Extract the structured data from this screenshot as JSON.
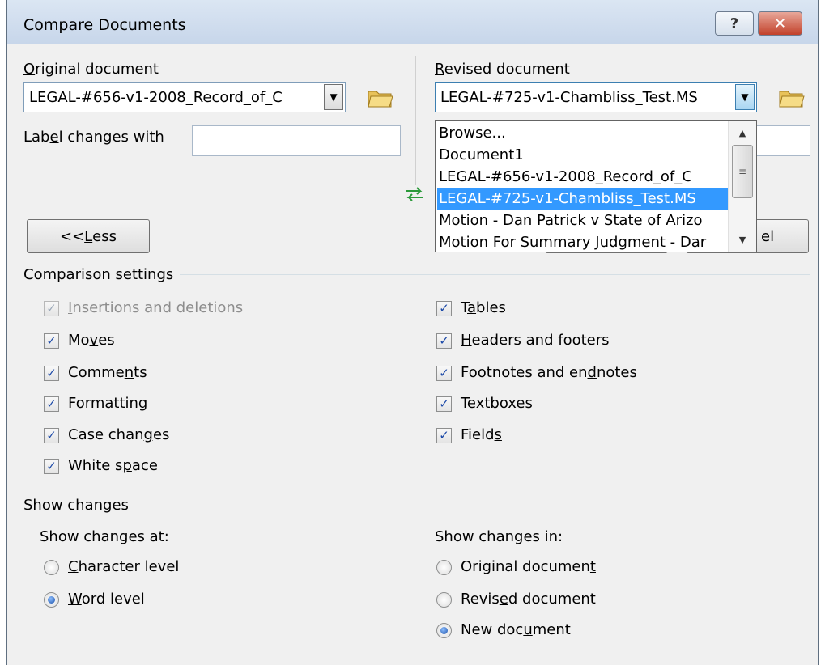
{
  "window": {
    "title": "Compare Documents",
    "help_label": "?",
    "close_label": "✕"
  },
  "original": {
    "label_pre": "",
    "label_u": "O",
    "label_post": "riginal document",
    "value": "LEGAL-#656-v1-2008_Record_of_C"
  },
  "revised": {
    "label_pre": "",
    "label_u": "R",
    "label_post": "evised document",
    "value": "LEGAL-#725-v1-Chambliss_Test.MS"
  },
  "label_changes": {
    "pre": "Lab",
    "u": "e",
    "post": "l changes with",
    "value": ""
  },
  "less_button": {
    "pre": "<< ",
    "u": "L",
    "post": "ess"
  },
  "cancel_partial": "el",
  "dropdown": {
    "items": [
      "Browse...",
      "Document1",
      "LEGAL-#656-v1-2008_Record_of_C",
      "LEGAL-#725-v1-Chambliss_Test.MS",
      "Motion - Dan Patrick v State of Arizo",
      "Motion For Summary Judgment - Dar"
    ],
    "selected_index": 3
  },
  "comparison_settings": {
    "title": "Comparison settings",
    "left": [
      {
        "pre": "",
        "u": "I",
        "post": "nsertions and deletions",
        "checked": true,
        "disabled": true
      },
      {
        "pre": "Mo",
        "u": "v",
        "post": "es",
        "checked": true,
        "disabled": false
      },
      {
        "pre": "Comme",
        "u": "n",
        "post": "ts",
        "checked": true,
        "disabled": false
      },
      {
        "pre": "",
        "u": "F",
        "post": "ormatting",
        "checked": true,
        "disabled": false
      },
      {
        "pre": "Case chan",
        "u": "g",
        "post": "es",
        "checked": true,
        "disabled": false
      },
      {
        "pre": "White s",
        "u": "p",
        "post": "ace",
        "checked": true,
        "disabled": false
      }
    ],
    "right": [
      {
        "pre": "T",
        "u": "a",
        "post": "bles",
        "checked": true
      },
      {
        "pre": "",
        "u": "H",
        "post": "eaders and footers",
        "checked": true
      },
      {
        "pre": "Footnotes and en",
        "u": "d",
        "post": "notes",
        "checked": true
      },
      {
        "pre": "Te",
        "u": "x",
        "post": "tboxes",
        "checked": true
      },
      {
        "pre": "Field",
        "u": "s",
        "post": "",
        "checked": true
      }
    ]
  },
  "show_changes": {
    "title": "Show changes",
    "at": {
      "label": "Show changes at:",
      "options": [
        {
          "pre": "",
          "u": "C",
          "post": "haracter level",
          "selected": false
        },
        {
          "pre": "",
          "u": "W",
          "post": "ord level",
          "selected": true
        }
      ]
    },
    "in": {
      "label": "Show changes in:",
      "options": [
        {
          "pre": "Original documen",
          "u": "t",
          "post": "",
          "selected": false
        },
        {
          "pre": "Revis",
          "u": "e",
          "post": "d document",
          "selected": false
        },
        {
          "pre": "New doc",
          "u": "u",
          "post": "ment",
          "selected": true
        }
      ]
    }
  }
}
